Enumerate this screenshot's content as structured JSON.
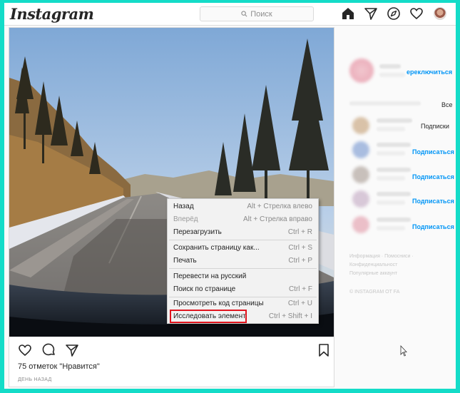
{
  "header": {
    "logo": "Instagram",
    "search_placeholder": "Поиск",
    "nav_icons": [
      "home-icon",
      "direct-icon",
      "explore-icon",
      "heart-icon",
      "avatar"
    ]
  },
  "post": {
    "likes": "75 отметок \"Нравится\"",
    "time": "ДЕНЬ НАЗАД"
  },
  "context_menu": {
    "items": [
      {
        "label": "Назад",
        "shortcut": "Alt + Стрелка влево",
        "disabled": false
      },
      {
        "label": "Вперёд",
        "shortcut": "Alt + Стрелка вправо",
        "disabled": true
      },
      {
        "label": "Перезагрузить",
        "shortcut": "Ctrl + R",
        "disabled": false
      },
      {
        "label": "Сохранить страницу как...",
        "shortcut": "Ctrl + S",
        "disabled": false
      },
      {
        "label": "Печать",
        "shortcut": "Ctrl + P",
        "disabled": false
      },
      {
        "label": "Перевести на русский",
        "shortcut": "",
        "disabled": false
      },
      {
        "label": "Поиск по странице",
        "shortcut": "Ctrl + F",
        "disabled": false
      },
      {
        "label": "Просмотреть код страницы",
        "shortcut": "Ctrl + U",
        "disabled": false
      },
      {
        "label": "Исследовать элемент",
        "shortcut": "Ctrl + Shift + I",
        "disabled": false
      }
    ],
    "highlight_color": "#e0141e"
  },
  "sidebar": {
    "switch_link": "ереключиться",
    "all_label": "Все",
    "subs_label": "Подписки",
    "follow_label": "Подписаться",
    "footer_links": "Информация · Помосниси ·",
    "footer_line2": "Конфиденциальност",
    "footer_line3": "Популярные аккаунт",
    "copyright": "© INSTAGRAM ОТ FA"
  },
  "colors": {
    "accent": "#0095f6",
    "frame": "#14dcc8"
  }
}
